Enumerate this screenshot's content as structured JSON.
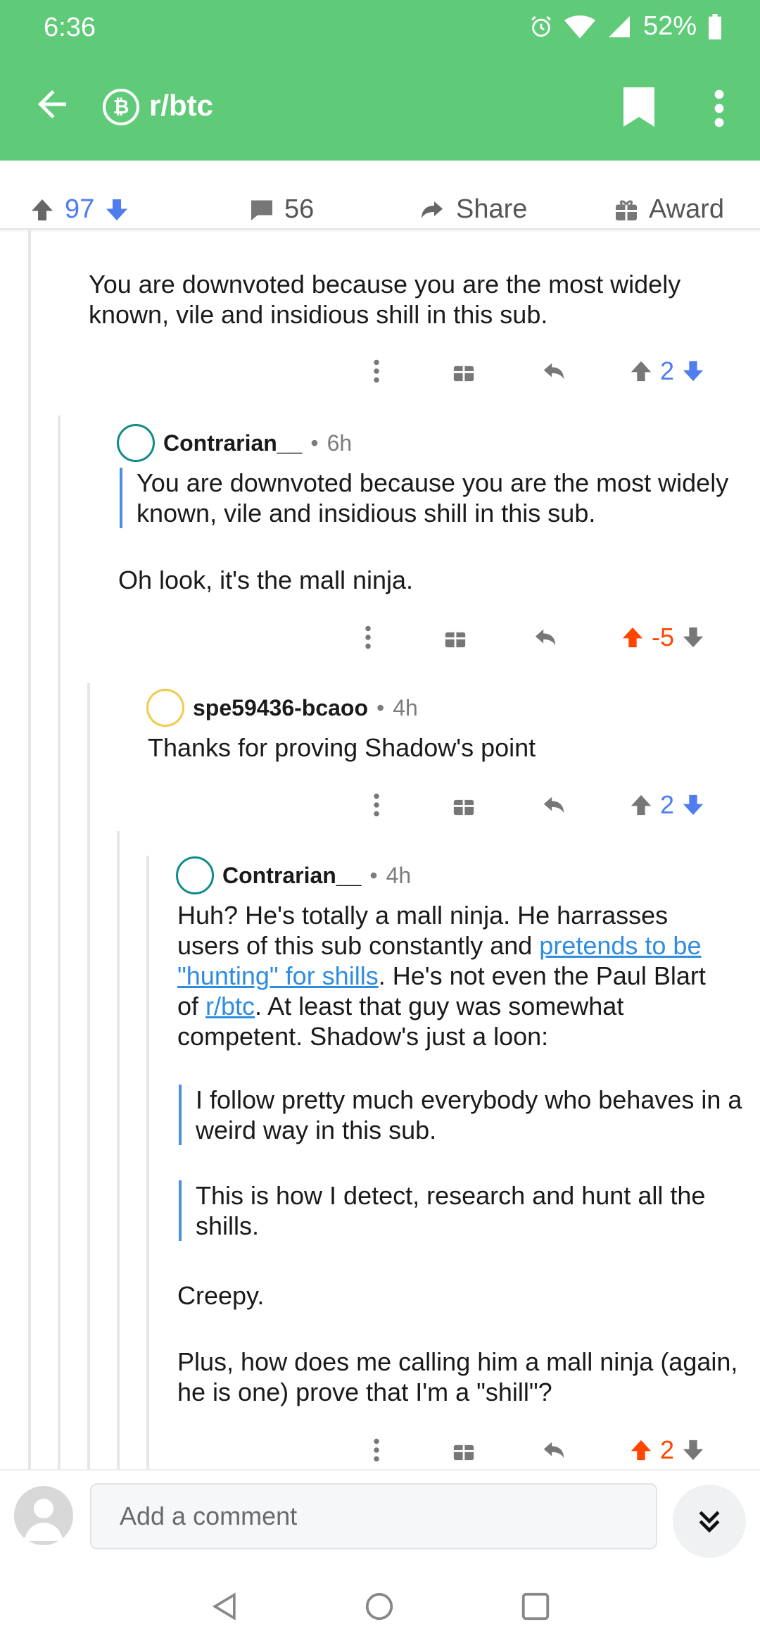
{
  "status": {
    "time": "6:36",
    "battery": "52%"
  },
  "app": {
    "subreddit": "r/btc"
  },
  "post_actions": {
    "score": "97",
    "comments": "56",
    "share": "Share",
    "award": "Award"
  },
  "comments": [
    {
      "body": "You are downvoted because you are the most widely known, vile and insidious shill in this sub.",
      "score": "2"
    },
    {
      "author": "Contrarian__",
      "time": "6h",
      "quote": "You are downvoted because you are the most widely known, vile and insidious shill in this sub.",
      "body": "Oh look, it's the mall ninja.",
      "score": "-5"
    },
    {
      "author": "spe59436-bcaoo",
      "time": "4h",
      "body": "Thanks for proving Shadow's point",
      "score": "2"
    },
    {
      "author": "Contrarian__",
      "time": "4h",
      "body_part1": "Huh? He's totally a mall ninja. He harrasses users of this sub constantly and ",
      "link1": "pretends to be \"hunting\" for shills",
      "body_part2": ". He's not even the Paul Blart of ",
      "link2": "r/btc",
      "body_part3": ". At least that guy was somewhat competent. Shadow's just a loon:",
      "quote1": "I follow pretty much everybody who behaves in a weird way in this sub.",
      "quote2": "This is how I detect, research and hunt all the shills.",
      "para2": "Creepy.",
      "para3": "Plus, how does me calling him a mall ninja (again, he is one) prove that I'm a \"shill\"?",
      "score": "2"
    }
  ],
  "composer": {
    "placeholder": "Add a comment"
  },
  "colors": {
    "brand": "#5fcb78",
    "upvote_active": "#ff4500",
    "vote_blue": "#4f7df0"
  },
  "icons": [
    "back-arrow-icon",
    "bitcoin-icon",
    "bookmark-icon",
    "more-vert-icon",
    "upvote-icon",
    "downvote-icon",
    "comment-icon",
    "share-icon",
    "award-icon",
    "gift-icon",
    "reply-icon",
    "chevron-double-down-icon",
    "nav-back-icon",
    "nav-home-icon",
    "nav-recents-icon"
  ]
}
